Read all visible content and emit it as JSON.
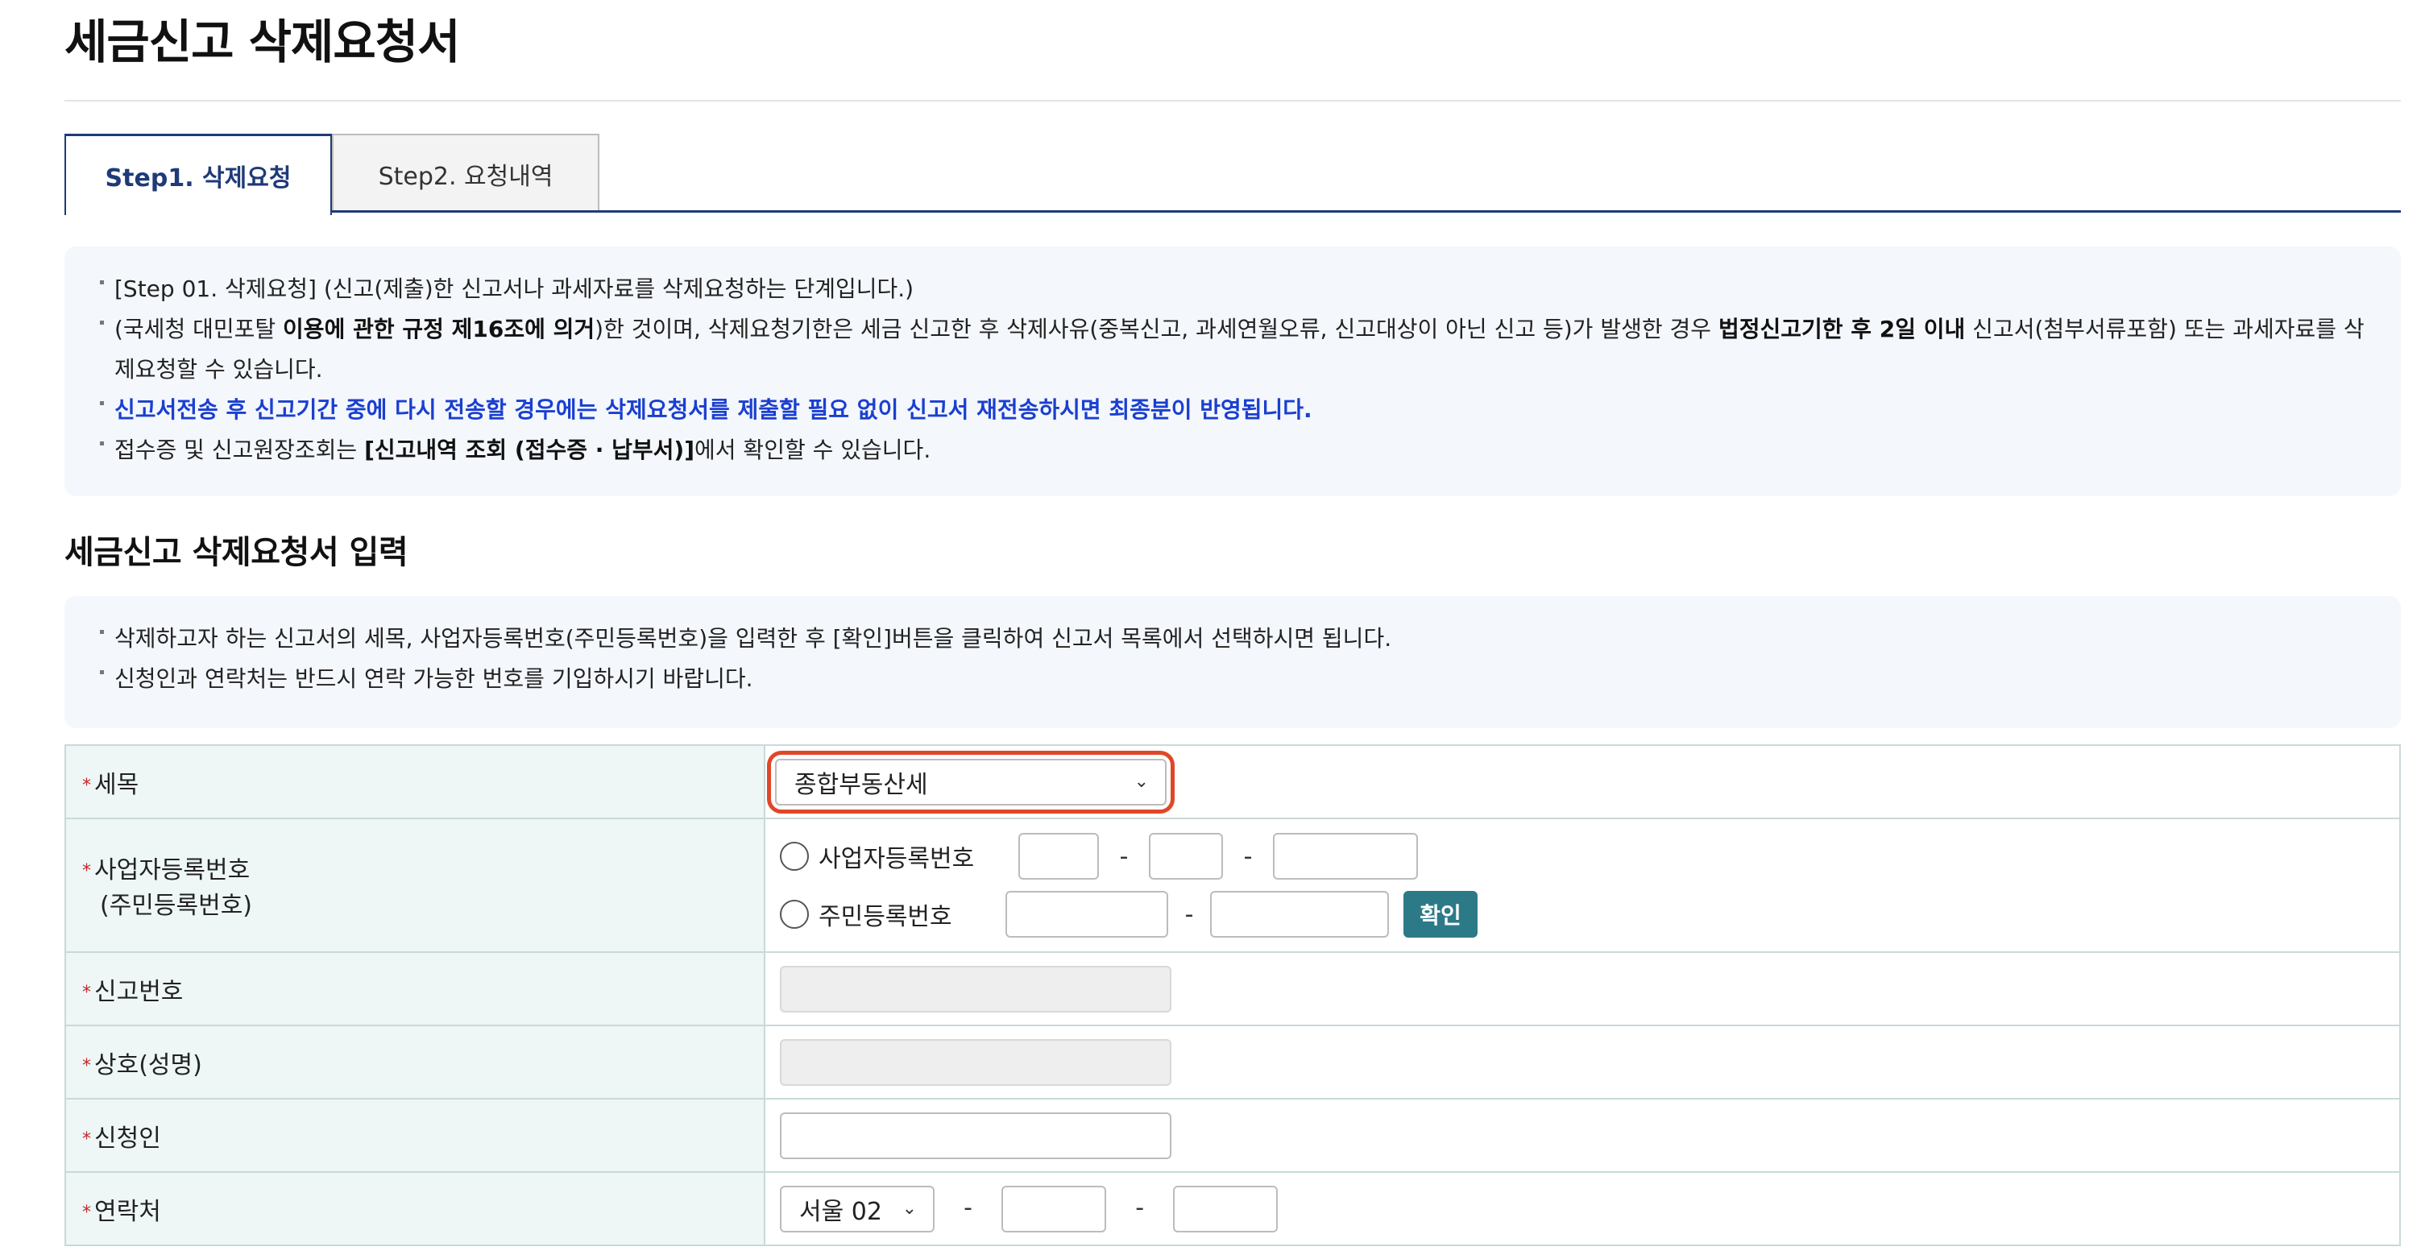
{
  "page": {
    "title": "세금신고 삭제요청서"
  },
  "tabs": [
    {
      "label": "Step1. 삭제요청",
      "active": true
    },
    {
      "label": "Step2. 요청내역",
      "active": false
    }
  ],
  "notice1": {
    "l1": "[Step 01. 삭제요청] (신고(제출)한 신고서나 과세자료를 삭제요청하는 단계입니다.)",
    "l2a": "(국세청 대민포탈 ",
    "l2b": "이용에 관한 규정 제16조에 의거",
    "l2c": ")한 것이며, 삭제요청기한은 세금 신고한 후 삭제사유(중복신고, 과세연월오류, 신고대상이 아닌 신고 등)가 발생한 경우 ",
    "l2d": "법정신고기한 후 2일 이내",
    "l2e": " 신고서(첨부서류포함) 또는 과세자료를 삭제요청할 수 있습니다.",
    "l3": "신고서전송 후 신고기간 중에 다시 전송할 경우에는 삭제요청서를 제출할 필요 없이 신고서 재전송하시면 최종분이 반영됩니다.",
    "l4a": "접수증 및 신고원장조회는 ",
    "l4b": "[신고내역 조회 (접수증 · 납부서)]",
    "l4c": "에서 확인할 수 있습니다."
  },
  "section": {
    "title": "세금신고 삭제요청서 입력"
  },
  "notice2": {
    "l1": "삭제하고자 하는 신고서의 세목, 사업자등록번호(주민등록번호)을 입력한 후 [확인]버튼을 클릭하여 신고서 목록에서 선택하시면 됩니다.",
    "l2": "신청인과 연락처는 반드시 연락 가능한 번호를 기입하시기 바랍니다."
  },
  "form": {
    "required_mark": "*",
    "tax_type_label": "세목",
    "tax_type_value": "종합부동산세",
    "biz_label_1": "사업자등록번호",
    "biz_label_2": "(주민등록번호)",
    "radio_biz": "사업자등록번호",
    "radio_rrn": "주민등록번호",
    "dash": "-",
    "confirm_button": "확인",
    "report_no_label": "신고번호",
    "name_label": "상호(성명)",
    "applicant_label": "신청인",
    "contact_label": "연락처",
    "area_code_value": "서울 02"
  },
  "icons": {
    "select_chevron": "chevron-down-icon"
  },
  "colors": {
    "accent_navy": "#1e3a78",
    "highlight_red": "#e04727",
    "confirm_teal": "#2c7a88",
    "notice_blue": "#1a3fd0"
  }
}
